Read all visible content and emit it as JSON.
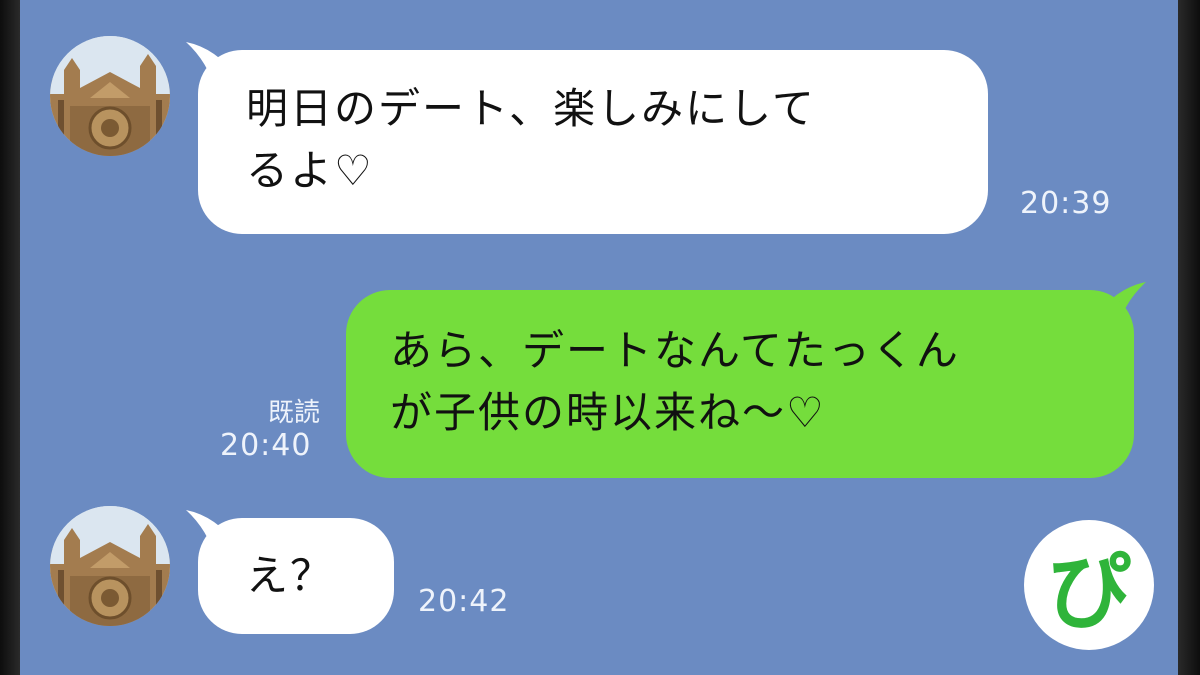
{
  "messages": [
    {
      "sender": "other",
      "text_line1": "明日のデート、楽しみにして",
      "text_line2": "るよ♡",
      "time": "20:39"
    },
    {
      "sender": "self",
      "text_line1": "あら、デートなんてたっくん",
      "text_line2": "が子供の時以来ね〜♡",
      "read_label": "既読",
      "time": "20:40"
    },
    {
      "sender": "other",
      "text_line1": "え？",
      "time": "20:42"
    }
  ],
  "logo": {
    "text": "ぴ"
  },
  "colors": {
    "background": "#6b8bc2",
    "incoming_bubble": "#ffffff",
    "outgoing_bubble": "#75dd3c",
    "logo_green": "#2fb43a"
  }
}
